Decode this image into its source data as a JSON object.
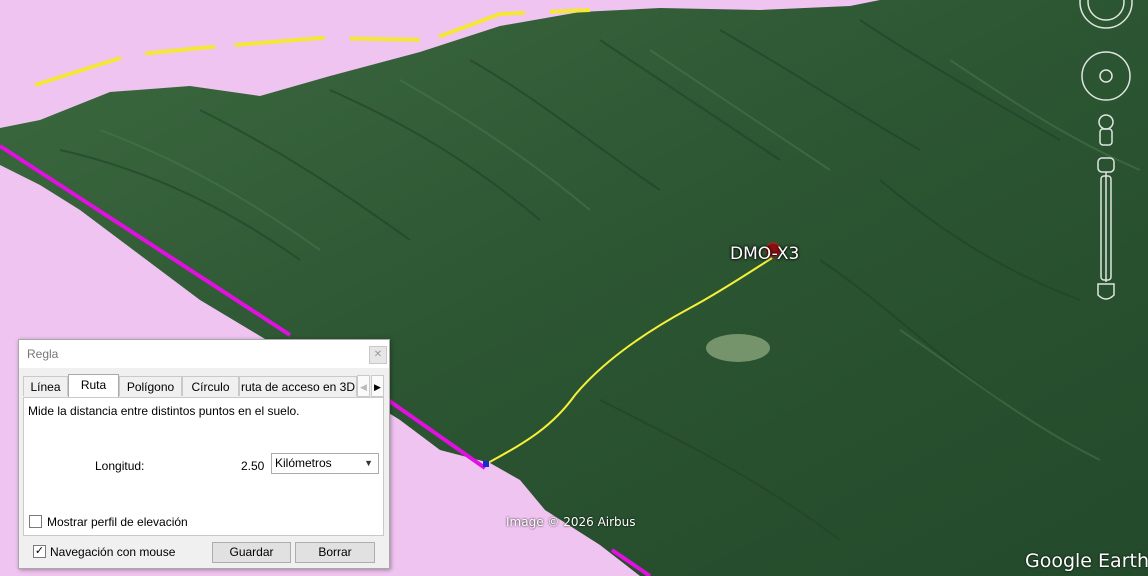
{
  "map": {
    "placemark_label": "DMO-X3",
    "copyright": "Image © 2026 Airbus",
    "brand": "Google Earth"
  },
  "dialog": {
    "title": "Regla",
    "close_icon": "close-icon",
    "tabs": [
      {
        "label": "Línea",
        "active": false
      },
      {
        "label": "Ruta",
        "active": true
      },
      {
        "label": "Polígono",
        "active": false
      },
      {
        "label": "Círculo",
        "active": false
      },
      {
        "label": "ruta de acceso en 3D",
        "active": false
      }
    ],
    "tab_scroll_left_icon": "chevron-left-icon",
    "tab_scroll_right_icon": "chevron-right-icon",
    "description": "Mide la distancia entre distintos puntos en el suelo.",
    "length_label": "Longitud:",
    "length_value": "2.50",
    "unit_selected": "Kilómetros",
    "elevation_profile_label": "Mostrar perfil de elevación",
    "elevation_profile_checked": false,
    "mouse_nav_label": "Navegación con mouse",
    "mouse_nav_checked": true,
    "save_label": "Guardar",
    "clear_label": "Borrar"
  },
  "colors": {
    "path_line": "#f5f03a",
    "boundary_line": "#e010e0",
    "dashed_line": "#f5e63a",
    "sky": "#f0c4f0",
    "terrain": "#2f5b34"
  }
}
